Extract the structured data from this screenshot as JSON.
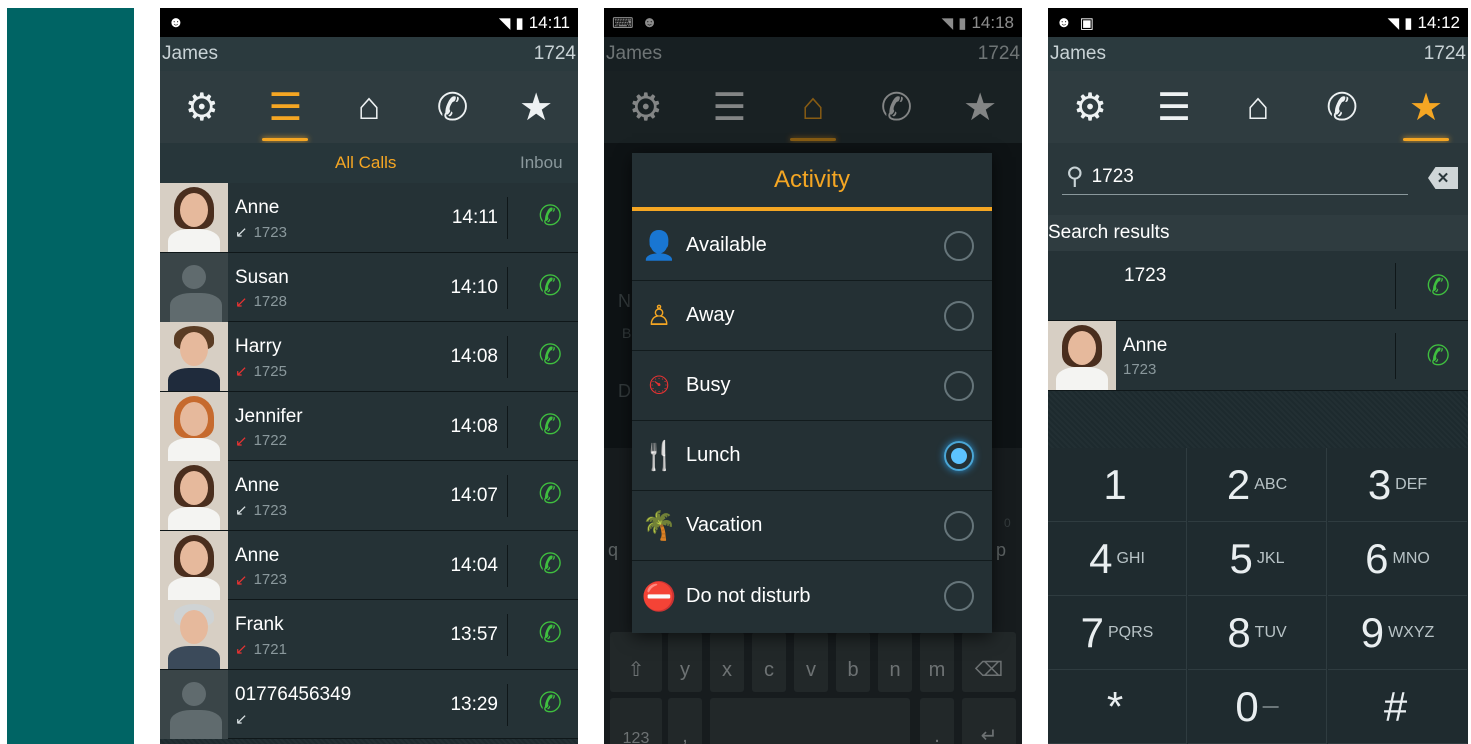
{
  "colors": {
    "accent": "#f5a623",
    "call_green": "#3fbf3f",
    "missed_red": "#e83232",
    "brand_teal": "#006464"
  },
  "user": {
    "name": "James",
    "extension": "1724"
  },
  "nav": [
    {
      "name": "settings",
      "icon": "gear-icon"
    },
    {
      "name": "call-list",
      "icon": "list-icon"
    },
    {
      "name": "home",
      "icon": "home-icon"
    },
    {
      "name": "dialer",
      "icon": "phone-icon"
    },
    {
      "name": "favorites",
      "icon": "star-icon"
    }
  ],
  "screen1": {
    "time": "14:11",
    "tabs": {
      "active": "All Calls",
      "next": "Inbou"
    },
    "calls": [
      {
        "name": "Anne",
        "number": "1723",
        "time": "14:11",
        "direction": "incoming"
      },
      {
        "name": "Susan",
        "number": "1728",
        "time": "14:10",
        "direction": "missed"
      },
      {
        "name": "Harry",
        "number": "1725",
        "time": "14:08",
        "direction": "missed"
      },
      {
        "name": "Jennifer",
        "number": "1722",
        "time": "14:08",
        "direction": "missed"
      },
      {
        "name": "Anne",
        "number": "1723",
        "time": "14:07",
        "direction": "incoming"
      },
      {
        "name": "Anne",
        "number": "1723",
        "time": "14:04",
        "direction": "missed"
      },
      {
        "name": "Frank",
        "number": "1721",
        "time": "13:57",
        "direction": "missed"
      },
      {
        "name": "01776456349",
        "number": "",
        "time": "13:29",
        "direction": "incoming"
      }
    ]
  },
  "screen2": {
    "time": "14:18",
    "dialog_title": "Activity",
    "options": [
      {
        "label": "Available",
        "icon": "person-available-icon",
        "selected": false
      },
      {
        "label": "Away",
        "icon": "person-away-icon",
        "selected": false
      },
      {
        "label": "Busy",
        "icon": "person-busy-icon",
        "selected": false
      },
      {
        "label": "Lunch",
        "icon": "fork-knife-icon",
        "selected": true
      },
      {
        "label": "Vacation",
        "icon": "palm-tree-icon",
        "selected": false
      },
      {
        "label": "Do not disturb",
        "icon": "no-entry-icon",
        "selected": false
      }
    ],
    "background_ghost": {
      "n": "N",
      "b": "B",
      "d": "D",
      "q": "q",
      "p": "p",
      "zero": "0",
      "num_key": "123",
      "comma": ",",
      "dot": "."
    },
    "keyboard_row": [
      "y",
      "x",
      "c",
      "v",
      "b",
      "n",
      "m"
    ]
  },
  "screen3": {
    "time": "14:12",
    "search_value": "1723",
    "results_header": "Search results",
    "results": [
      {
        "name": "",
        "number": "1723"
      },
      {
        "name": "Anne",
        "number": "1723"
      }
    ],
    "dialpad": [
      {
        "digit": "1",
        "letters": ""
      },
      {
        "digit": "2",
        "letters": "ABC"
      },
      {
        "digit": "3",
        "letters": "DEF"
      },
      {
        "digit": "4",
        "letters": "GHI"
      },
      {
        "digit": "5",
        "letters": "JKL"
      },
      {
        "digit": "6",
        "letters": "MNO"
      },
      {
        "digit": "7",
        "letters": "PQRS"
      },
      {
        "digit": "8",
        "letters": "TUV"
      },
      {
        "digit": "9",
        "letters": "WXYZ"
      },
      {
        "digit": "*",
        "letters": ""
      },
      {
        "digit": "0",
        "letters": "—"
      },
      {
        "digit": "#",
        "letters": ""
      }
    ]
  }
}
